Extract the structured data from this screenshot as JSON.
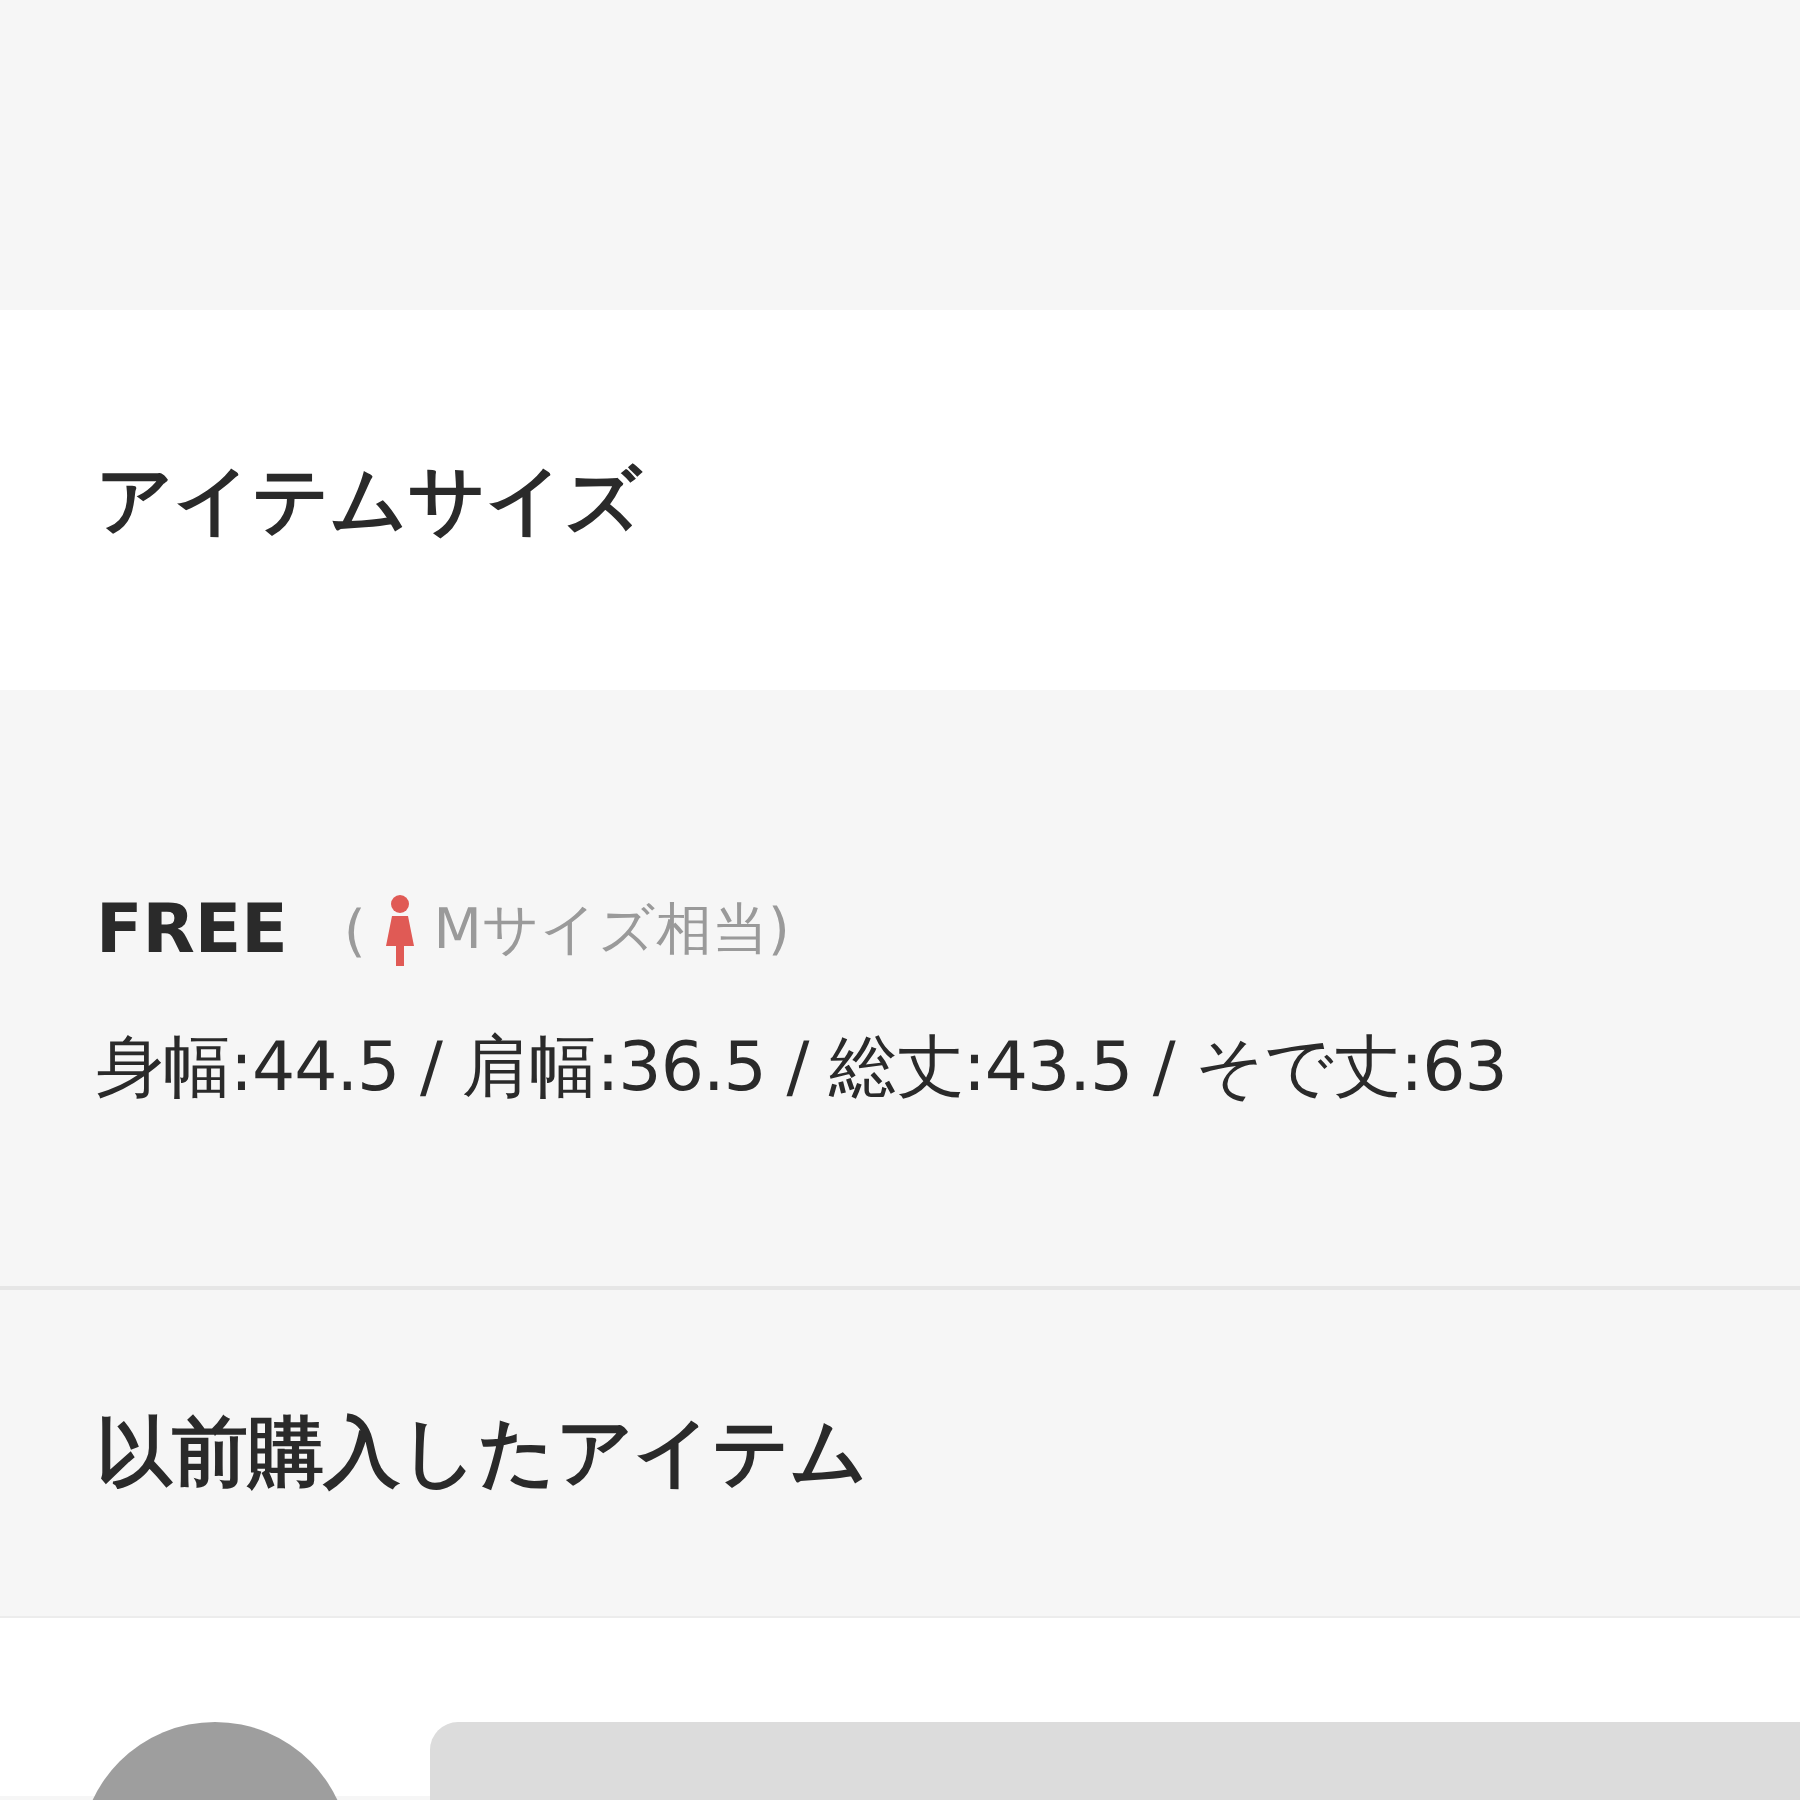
{
  "item_size": {
    "title": "アイテムサイズ",
    "size": "FREE",
    "open_paren": "(",
    "equivalent": "Mサイズ相当)",
    "measurements": "身幅:44.5 / 肩幅:36.5 / 総丈:43.5 / そで丈:63"
  },
  "purchased": {
    "title": "以前購入したアイテム"
  }
}
